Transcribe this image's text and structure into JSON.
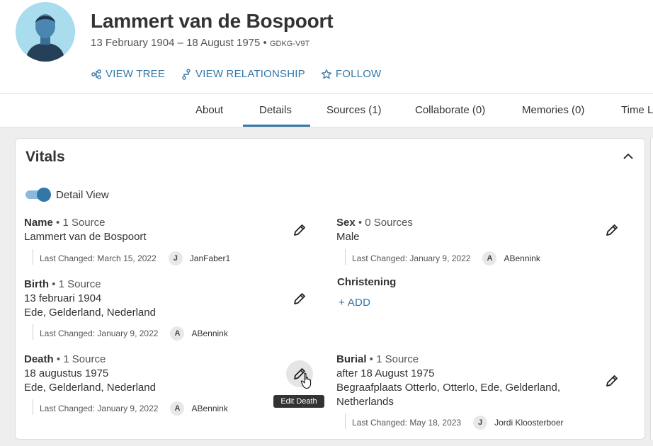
{
  "person": {
    "name": "Lammert van de Bospoort",
    "lifespan": "13 February 1904 – 18 August 1975 •",
    "pid": "GDKG-V9T"
  },
  "actions": [
    {
      "label": "VIEW TREE",
      "icon": "tree-icon"
    },
    {
      "label": "VIEW RELATIONSHIP",
      "icon": "relationship-icon"
    },
    {
      "label": "FOLLOW",
      "icon": "star-icon"
    }
  ],
  "tabs": [
    {
      "label": "About"
    },
    {
      "label": "Details",
      "active": true
    },
    {
      "label": "Sources (1)"
    },
    {
      "label": "Collaborate (0)"
    },
    {
      "label": "Memories (0)"
    },
    {
      "label": "Time L"
    }
  ],
  "vitals": {
    "title": "Vitals",
    "toggle_label": "Detail View",
    "name": {
      "label": "Name",
      "sources": " • 1 Source",
      "lines": [
        "Lammert van de Bospoort"
      ],
      "changed": "Last Changed: March 15, 2022",
      "initial": "J",
      "user": "JanFaber1"
    },
    "sex": {
      "label": "Sex",
      "sources": " • 0 Sources",
      "lines": [
        "Male"
      ],
      "changed": "Last Changed: January 9, 2022",
      "initial": "A",
      "user": "ABennink"
    },
    "birth": {
      "label": "Birth",
      "sources": " • 1 Source",
      "lines": [
        "13 februari 1904",
        "Ede, Gelderland, Nederland"
      ],
      "changed": "Last Changed: January 9, 2022",
      "initial": "A",
      "user": "ABennink"
    },
    "christening": {
      "label": "Christening",
      "add_label": "+ ADD"
    },
    "death": {
      "label": "Death",
      "sources": " • 1 Source",
      "lines": [
        "18 augustus 1975",
        "Ede, Gelderland, Nederland"
      ],
      "changed": "Last Changed: January 9, 2022",
      "initial": "A",
      "user": "ABennink",
      "tooltip": "Edit Death"
    },
    "burial": {
      "label": "Burial",
      "sources": " • 1 Source",
      "lines": [
        "after 18 August 1975",
        "Begraafplaats Otterlo, Otterlo, Ede, Gelderland,",
        "Netherlands"
      ],
      "changed": "Last Changed: May 18, 2023",
      "initial": "J",
      "user": "Jordi Kloosterboer"
    }
  },
  "colors": {
    "accent": "#3277a8",
    "page_bg": "#eeeeee",
    "avatar_bg": "#a9dced"
  }
}
